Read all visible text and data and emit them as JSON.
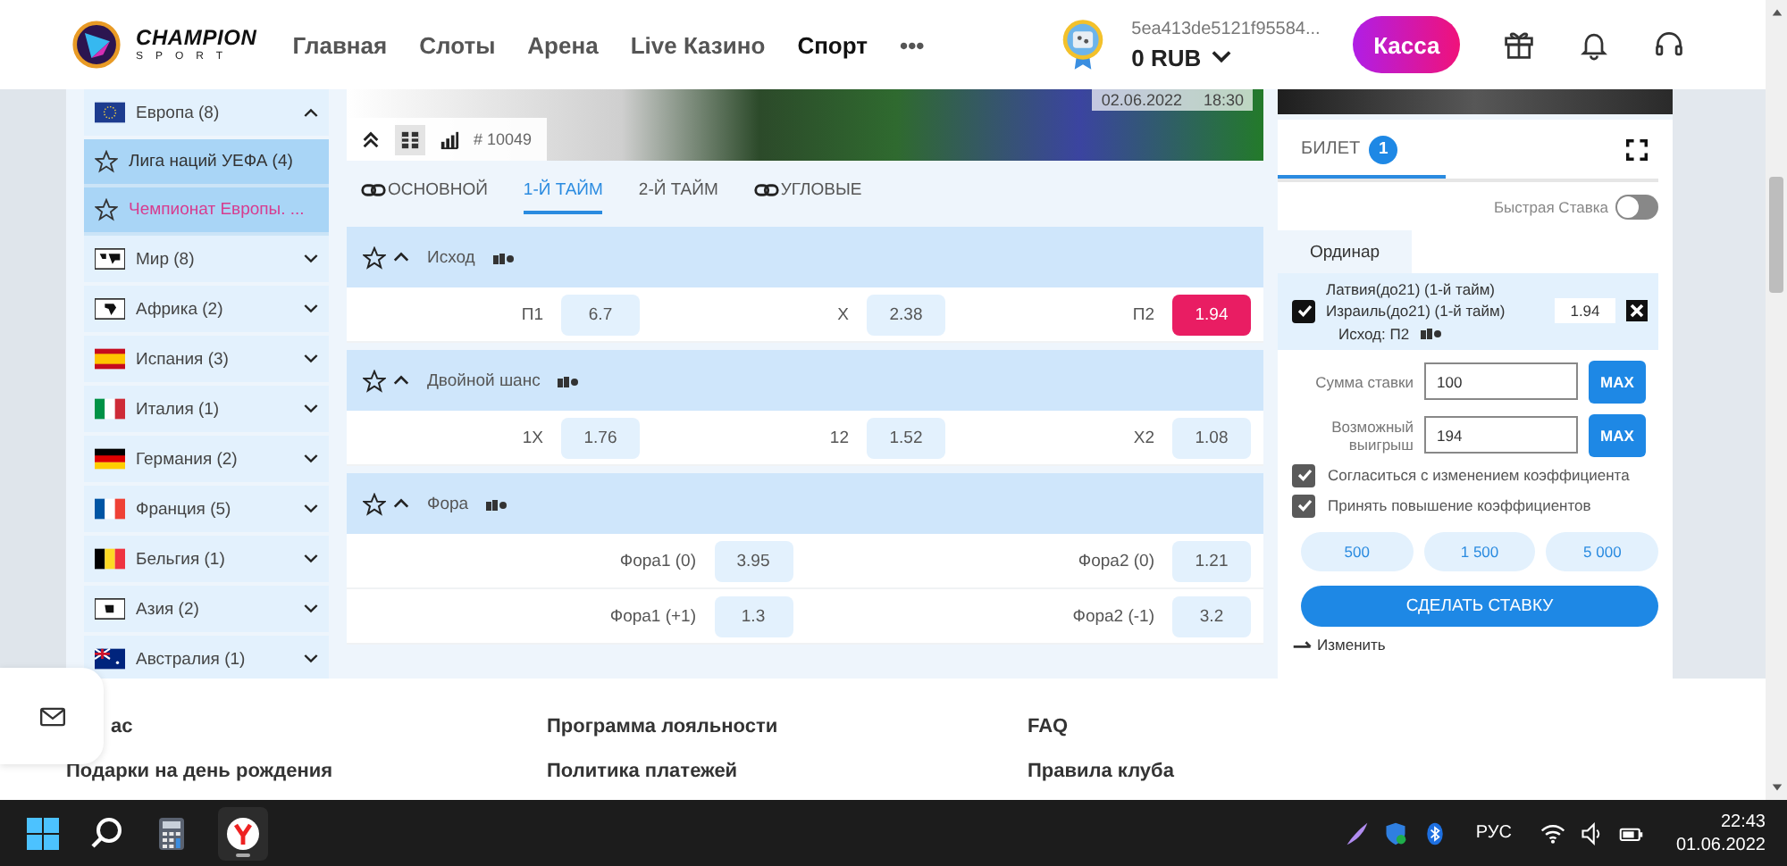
{
  "header": {
    "logo_title": "CHAMPION",
    "logo_subtitle": "SPORT",
    "nav": [
      {
        "label": "Главная",
        "selected": false
      },
      {
        "label": "Слоты",
        "selected": false
      },
      {
        "label": "Арена",
        "selected": false
      },
      {
        "label": "Live Казино",
        "selected": false
      },
      {
        "label": "Спорт",
        "selected": true
      }
    ],
    "more": "•••",
    "account_id": "5ea413de5121f95584...",
    "balance": "0 RUB",
    "cashier_button": "Касса"
  },
  "sidebar": {
    "items": [
      {
        "label": "Европа (8)",
        "kind": "eu",
        "expanded": true,
        "children": [
          {
            "label": "Лига наций УЕФА (4)",
            "selected": false
          },
          {
            "label": "Чемпионат Европы. ...",
            "selected": true
          }
        ]
      },
      {
        "label": "Мир (8)",
        "kind": "world",
        "expanded": false
      },
      {
        "label": "Африка (2)",
        "kind": "africa",
        "expanded": false
      },
      {
        "label": "Испания (3)",
        "kind": "spain",
        "expanded": false
      },
      {
        "label": "Италия (1)",
        "kind": "italy",
        "expanded": false
      },
      {
        "label": "Германия (2)",
        "kind": "germany",
        "expanded": false
      },
      {
        "label": "Франция (5)",
        "kind": "france",
        "expanded": false
      },
      {
        "label": "Бельгия (1)",
        "kind": "belgium",
        "expanded": false
      },
      {
        "label": "Азия (2)",
        "kind": "asia",
        "expanded": false
      },
      {
        "label": "Австралия (1)",
        "kind": "australia",
        "expanded": false
      }
    ]
  },
  "event": {
    "date": "02.06.2022",
    "time": "18:30",
    "match_id": "# 10049",
    "tabs": [
      {
        "label": "ОСНОВНОЙ",
        "linked": true,
        "selected": false
      },
      {
        "label": "1-Й ТАЙМ",
        "linked": false,
        "selected": true
      },
      {
        "label": "2-Й ТАЙМ",
        "linked": false,
        "selected": false
      },
      {
        "label": "УГЛОВЫЕ",
        "linked": true,
        "selected": false
      }
    ],
    "markets": [
      {
        "title": "Исход",
        "rows": [
          [
            {
              "label": "П1",
              "odd": "6.7",
              "selected": false
            },
            {
              "label": "X",
              "odd": "2.38",
              "selected": false
            },
            {
              "label": "П2",
              "odd": "1.94",
              "selected": true
            }
          ]
        ]
      },
      {
        "title": "Двойной шанс",
        "rows": [
          [
            {
              "label": "1X",
              "odd": "1.76",
              "selected": false
            },
            {
              "label": "12",
              "odd": "1.52",
              "selected": false
            },
            {
              "label": "X2",
              "odd": "1.08",
              "selected": false
            }
          ]
        ]
      },
      {
        "title": "Фора",
        "rows": [
          [
            {
              "label": "Фора1 (0)",
              "odd": "3.95",
              "selected": false
            },
            {
              "label": "Фора2 (0)",
              "odd": "1.21",
              "selected": false
            }
          ],
          [
            {
              "label": "Фора1 (+1)",
              "odd": "1.3",
              "selected": false
            },
            {
              "label": "Фора2 (-1)",
              "odd": "3.2",
              "selected": false
            }
          ]
        ]
      }
    ]
  },
  "betslip": {
    "tab": "БИЛЕТ",
    "count": "1",
    "quick_bet": {
      "label": "Быстрая Ставка",
      "on": false
    },
    "mode_tab": "Ординар",
    "selection": {
      "checked": true,
      "team1": "Латвия(до21) (1-й тайм)",
      "team2": "Израиль(до21) (1-й тайм)",
      "outcome": "Исход: П2",
      "odd": "1.94"
    },
    "stake_label": "Сумма ставки",
    "stake": "100",
    "win_label": "Возможный выигрыш",
    "win": "194",
    "stake_max_button": "MAX",
    "win_max_button": "MAX",
    "options": [
      {
        "label": "Согласиться с изменением коэффициента",
        "checked": true
      },
      {
        "label": "Принять повышение коэффициентов",
        "checked": true
      }
    ],
    "chips": [
      "500",
      "1 500",
      "5 000"
    ],
    "submit": "СДЕЛАТЬ СТАВКУ",
    "change": "Изменить"
  },
  "footer": {
    "columns": [
      [
        "ас",
        "Подарки на день рождения"
      ],
      [
        "Программа лояльности",
        "Политика платежей"
      ],
      [
        "FAQ",
        "Правила клуба"
      ]
    ]
  },
  "taskbar": {
    "language": "РУС",
    "time": "22:43",
    "date": "01.06.2022"
  }
}
